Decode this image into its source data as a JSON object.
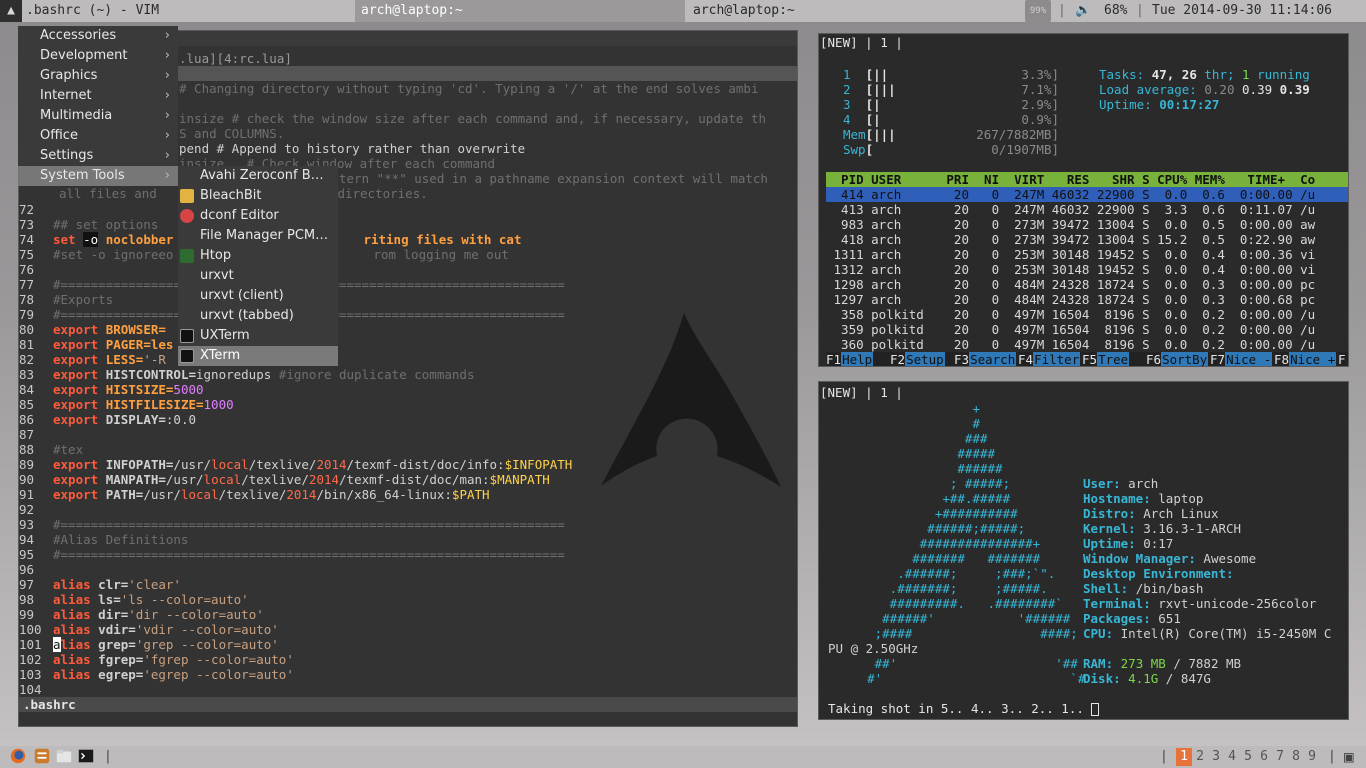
{
  "topbar": {
    "launcher_glyph": "▲",
    "window_title": ".bashrc (~) - VIM",
    "task1": "arch@laptop:~",
    "task2": "arch@laptop:~",
    "battery_badge": "99%",
    "sep": "|",
    "volume_icon": "🔊",
    "volume": "68%",
    "clock": "Tue 2014-09-30 11:14:06"
  },
  "menu": {
    "items": [
      {
        "label": "Accessories",
        "arrow": "›"
      },
      {
        "label": "Development",
        "arrow": "›"
      },
      {
        "label": "Graphics",
        "arrow": "›"
      },
      {
        "label": "Internet",
        "arrow": "›"
      },
      {
        "label": "Multimedia",
        "arrow": "›"
      },
      {
        "label": "Office",
        "arrow": "›"
      },
      {
        "label": "Settings",
        "arrow": "›"
      },
      {
        "label": "System Tools",
        "arrow": "›"
      }
    ],
    "submenu": [
      {
        "label": "Avahi Zeroconf B…",
        "icon": "none"
      },
      {
        "label": "BleachBit",
        "icon": "bleachbit-icon"
      },
      {
        "label": "dconf Editor",
        "icon": "dconf-icon"
      },
      {
        "label": "File Manager PCM…",
        "icon": "none"
      },
      {
        "label": "Htop",
        "icon": "htop-icon"
      },
      {
        "label": "urxvt",
        "icon": "none"
      },
      {
        "label": "urxvt (client)",
        "icon": "none"
      },
      {
        "label": "urxvt (tabbed)",
        "icon": "none"
      },
      {
        "label": "UXTerm",
        "icon": "terminal-icon"
      },
      {
        "label": "XTerm",
        "icon": "terminal-icon"
      }
    ]
  },
  "vim": {
    "tabline_fragment": ".lua][4:rc.lua]",
    "hidden_lines": [
      "# Changing directory without typing 'cd'. Typing a '/' at the end solves ambi",
      "insize # check the window size after each command and, if necessary, update th",
      "S and COLUMNS.",
      "pend # Append to history rather than overwrite",
      "insize   # Check window after each command",
      "tern \"**\" used in a pathname expansion context will match",
      "all files and             ies and subdirectories."
    ],
    "status_file": ".bashrc",
    "lines": {
      "l72": "72",
      "l73": "73",
      "l74": "74",
      "l75": "75",
      "l76": "76",
      "l77": "77",
      "l78": "78",
      "l79": "79",
      "l80": "80",
      "l81": "81",
      "l82": "82",
      "l83": "83",
      "l84": "84",
      "l85": "85",
      "l86": "86",
      "l87": "87",
      "l88": "88",
      "l89": "89",
      "l90": "90",
      "l91": "91",
      "l92": "92",
      "l93": "93",
      "l94": "94",
      "l95": "95",
      "l96": "96",
      "l97": "97",
      "l98": "98",
      "l99": "99",
      "l100": "100",
      "l101": "101",
      "l102": "102",
      "l103": "103",
      "l104": "104"
    },
    "code": {
      "c73": "## set options",
      "c74a": "set",
      "c74b": "-o",
      "c74c": "noclobber",
      "c74d": "riting files with cat",
      "c75a": "#set -o ignoreeo",
      "c75b": "rom logging me out",
      "c76": "#===================================================================",
      "c77": "#Exports",
      "c78": "#===================================================================",
      "c80a": "export",
      "c80b": "BROWSER=",
      "c81a": "export",
      "c81b": "PAGER=",
      "c81c": "les",
      "c82a": "export",
      "c82b": "LESS=",
      "c82c": "'-R",
      "c83a": "export",
      "c83b": "HISTCONTROL=",
      "c83c": "ignoredups",
      "c83d": "#ignore duplicate commands",
      "c84a": "export",
      "c84b": "HISTSIZE=",
      "c84c": "5000",
      "c85a": "export",
      "c85b": "HISTFILESIZE=",
      "c85c": "1000",
      "c86a": "export",
      "c86b": "DISPLAY=",
      "c86c": ":0.0",
      "c88": "#tex",
      "c89a": "export",
      "c89b": "INFOPATH=",
      "c89c": "/usr/",
      "c89d": "local",
      "c89e": "/texlive/",
      "c89f": "2014",
      "c89g": "/texmf-dist/doc/info:",
      "c89h": "$INFOPATH",
      "c90a": "export",
      "c90b": "MANPATH=",
      "c90c": "/usr/",
      "c90d": "local",
      "c90e": "/texlive/",
      "c90f": "2014",
      "c90g": "/texmf-dist/doc/man:",
      "c90h": "$MANPATH",
      "c91a": "export",
      "c91b": "PATH=",
      "c91c": "/usr/",
      "c91d": "local",
      "c91e": "/texlive/",
      "c91f": "2014",
      "c91g": "/bin/x86_64-linux:",
      "c91h": "$PATH",
      "c93": "#===================================================================",
      "c94": "#Alias Definitions",
      "c95": "#===================================================================",
      "c97a": "alias",
      "c97b": "clr=",
      "c97c": "'clear'",
      "c98a": "alias",
      "c98b": "ls=",
      "c98c": "'ls --color=auto'",
      "c99a": "alias",
      "c99b": "dir=",
      "c99c": "'dir --color=auto'",
      "c100a": "alias",
      "c100b": "vdir=",
      "c100c": "'vdir --color=auto'",
      "c101cur": "a",
      "c101a": "lias",
      "c101b": "grep=",
      "c101c": "'grep --color=auto'",
      "c102a": "alias",
      "c102b": "fgrep=",
      "c102c": "'fgrep --color=auto'",
      "c103a": "alias",
      "c103b": "egrep=",
      "c103c": "'egrep --color=auto'"
    }
  },
  "htop": {
    "tabbar": "[NEW] | 1 |",
    "cpus": [
      {
        "n": "1",
        "bar": "[||",
        "pct": "3.3%]"
      },
      {
        "n": "2",
        "bar": "[|||",
        "pct": "7.1%]"
      },
      {
        "n": "3",
        "bar": "[|",
        "pct": "2.9%]"
      },
      {
        "n": "4",
        "bar": "[|",
        "pct": "0.9%]"
      }
    ],
    "mem_label": "Mem",
    "mem_bar": "[|||",
    "mem_val": "267/7882MB]",
    "swp_label": "Swp",
    "swp_bar": "[",
    "swp_val": "0/1907MB]",
    "tasks_label": "Tasks:",
    "tasks_val": "47,",
    "thr_val": "26",
    "thr_label": "thr;",
    "running_val": "1",
    "running_label": "running",
    "load_label": "Load average:",
    "load1": "0.20",
    "load5": "0.39",
    "load15": "0.39",
    "uptime_label": "Uptime:",
    "uptime_val": "00:17:27",
    "header": "  PID USER      PRI  NI  VIRT   RES   SHR S CPU% MEM%   TIME+  Co",
    "rows": [
      "  414 arch       20   0  247M 46032 22900 S  0.0  0.6  0:00.00 /u",
      "  413 arch       20   0  247M 46032 22900 S  3.3  0.6  0:11.07 /u",
      "  983 arch       20   0  273M 39472 13004 S  0.0  0.5  0:00.00 aw",
      "  418 arch       20   0  273M 39472 13004 S 15.2  0.5  0:22.90 aw",
      " 1311 arch       20   0  253M 30148 19452 S  0.0  0.4  0:00.36 vi",
      " 1312 arch       20   0  253M 30148 19452 S  0.0  0.4  0:00.00 vi",
      " 1298 arch       20   0  484M 24328 18724 S  0.0  0.3  0:00.00 pc",
      " 1297 arch       20   0  484M 24328 18724 S  0.0  0.3  0:00.68 pc",
      "  358 polkitd    20   0  497M 16504  8196 S  0.0  0.2  0:00.00 /u",
      "  359 polkitd    20   0  497M 16504  8196 S  0.0  0.2  0:00.00 /u",
      "  360 polkitd    20   0  497M 16504  8196 S  0.0  0.2  0:00.00 /u"
    ],
    "fkeys": [
      {
        "k": "F1",
        "l": "Help"
      },
      {
        "k": "F2",
        "l": "Setup"
      },
      {
        "k": "F3",
        "l": "Search"
      },
      {
        "k": "F4",
        "l": "Filter"
      },
      {
        "k": "F5",
        "l": "Tree"
      },
      {
        "k": "F6",
        "l": "SortBy"
      },
      {
        "k": "F7",
        "l": "Nice -"
      },
      {
        "k": "F8",
        "l": "Nice +"
      },
      {
        "k": "F",
        "l": ""
      }
    ]
  },
  "sysinfo": {
    "tabbar": "[NEW] | 1 |",
    "logo": [
      "                  +",
      "                  #",
      "                 ###",
      "                #####",
      "                ######",
      "               ; #####;",
      "              +##.#####",
      "             +##########",
      "            ######;#####;",
      "           ###############+",
      "          #######   #######",
      "        .######;     ;###;`\".",
      "       .#######;     ;#####.",
      "       #########.   .########`",
      "      ######'           '######",
      "     ;####                 ####;",
      "     ##'                     '##",
      "    #'                         `#"
    ],
    "labels": {
      "user": "User:",
      "hostname": "Hostname:",
      "distro": "Distro:",
      "kernel": "Kernel:",
      "uptime": "Uptime:",
      "wm": "Window Manager:",
      "de": "Desktop Environment:",
      "shell": "Shell:",
      "terminal": "Terminal:",
      "packages": "Packages:",
      "cpu": "CPU:",
      "ram": "RAM:",
      "disk": "Disk:"
    },
    "values": {
      "user": "arch",
      "hostname": "laptop",
      "distro": "Arch Linux",
      "kernel": "3.16.3-1-ARCH",
      "uptime": "0:17",
      "wm": "Awesome",
      "de": "",
      "shell": "/bin/bash",
      "terminal": "rxvt-unicode-256color",
      "packages": "651",
      "cpu": "Intel(R) Core(TM) i5-2450M C",
      "cpu_wrap": "PU @ 2.50GHz",
      "ram_used": "273 MB",
      "ram_total": " / 7882 MB",
      "disk_used": "4.1G",
      "disk_total": " / 847G"
    },
    "prompt": "Taking shot in 5.. 4.. 3.. 2.. 1.."
  },
  "bottombar": {
    "sep": "|",
    "tags": [
      "1",
      "2",
      "3",
      "4",
      "5",
      "6",
      "7",
      "8",
      "9"
    ],
    "layout_icon": "▣"
  }
}
